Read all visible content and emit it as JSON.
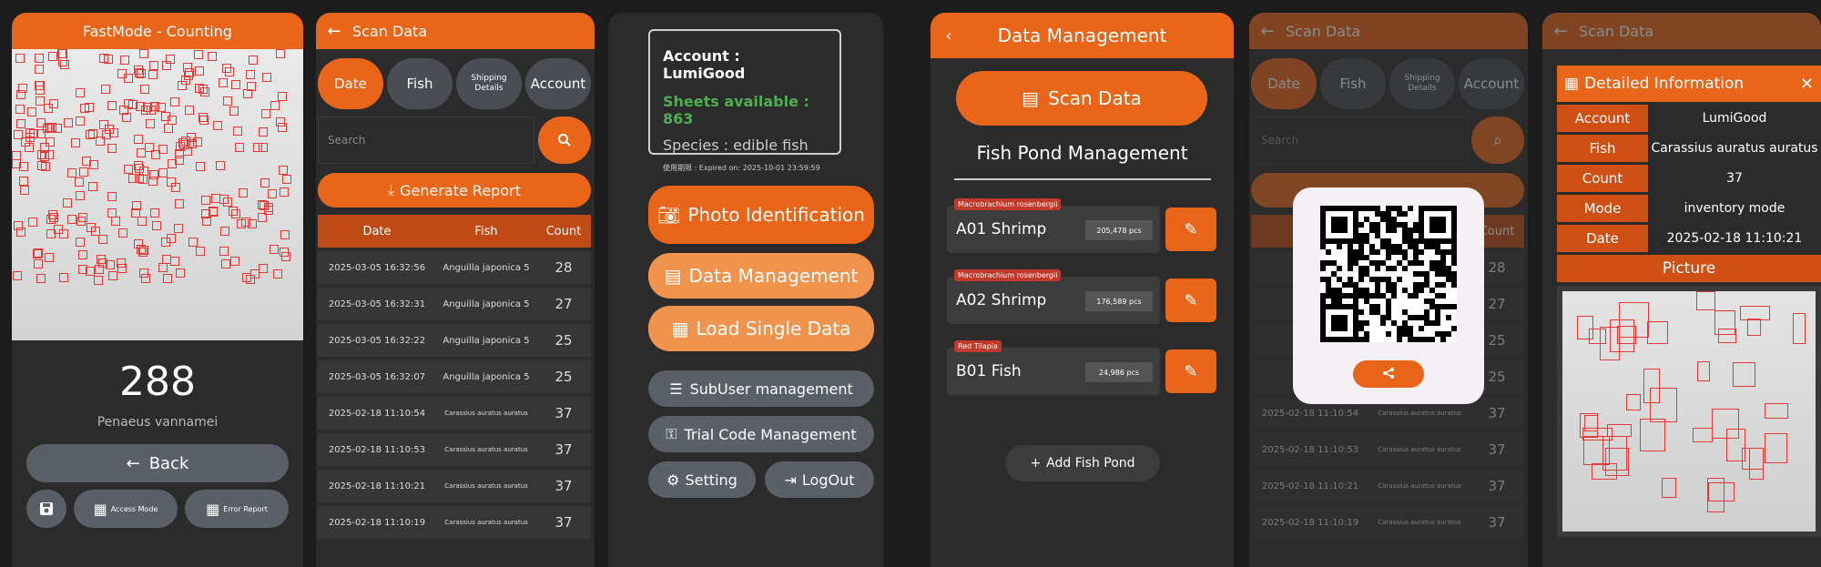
{
  "panel1": {
    "title": "FastMode - Counting",
    "count": "288",
    "species": "Penaeus vannamei",
    "back_label": "Back",
    "btn2_label": "Access Mode",
    "btn3_label": "Error Report"
  },
  "panel2": {
    "title": "Scan Data",
    "tabs": [
      "Date",
      "Fish",
      "Shipping Details",
      "Account"
    ],
    "search_placeholder": "Search",
    "generate_label": "Generate Report",
    "columns": [
      "Date",
      "Fish",
      "Count"
    ],
    "rows": [
      {
        "date": "2025-03-05 16:32:56",
        "fish": "Anguilla japonica 5",
        "count": "28"
      },
      {
        "date": "2025-03-05 16:32:31",
        "fish": "Anguilla japonica 5",
        "count": "27"
      },
      {
        "date": "2025-03-05 16:32:22",
        "fish": "Anguilla japonica 5",
        "count": "25"
      },
      {
        "date": "2025-03-05 16:32:07",
        "fish": "Anguilla japonica 5",
        "count": "25"
      },
      {
        "date": "2025-02-18 11:10:54",
        "fish": "Carassius auratus auratus",
        "count": "37"
      },
      {
        "date": "2025-02-18 11:10:53",
        "fish": "Carassius auratus auratus",
        "count": "37"
      },
      {
        "date": "2025-02-18 11:10:21",
        "fish": "Carassius auratus auratus",
        "count": "37"
      },
      {
        "date": "2025-02-18 11:10:19",
        "fish": "Carassius auratus auratus",
        "count": "37"
      }
    ]
  },
  "panel3": {
    "account": "Account : LumiGood",
    "sheets": "Sheets available : 863",
    "species": "Species : edible fish",
    "expired": "使用期限 : Expired on: 2025-10-01 23:59:59",
    "photo_id": "Photo Identification",
    "data_mgmt": "Data Management",
    "load_single": "Load Single Data",
    "subuser": "SubUser management",
    "trial_code": "Trial Code Management",
    "setting": "Setting",
    "logout": "LogOut"
  },
  "panel4": {
    "title": "Data Management",
    "scan_data": "Scan Data",
    "section_title": "Fish Pond Management",
    "ponds": [
      {
        "tag": "Macrobrachium rosenbergii",
        "name": "A01 Shrimp",
        "count": "205,478 pcs"
      },
      {
        "tag": "Macrobrachium rosenbergii",
        "name": "A02 Shrimp",
        "count": "176,589 pcs"
      },
      {
        "tag": "Red Tilapia",
        "name": "B01 Fish",
        "count": "24,986 pcs"
      }
    ],
    "add_pond": "Add Fish Pond"
  },
  "panel5": {
    "title": "Scan Data",
    "tabs": [
      "Date",
      "Fish",
      "Shipping Details",
      "Account"
    ],
    "search_placeholder": "Search",
    "count_header": "Count",
    "rows": [
      {
        "date": "2025",
        "count": "28"
      },
      {
        "date": "",
        "count": "27"
      },
      {
        "date": "",
        "count": "25"
      },
      {
        "date": "",
        "count": "25"
      },
      {
        "date": "2025-02-18 11:10:54",
        "fish": "Carassius auratus auratus",
        "count": "37"
      },
      {
        "date": "2025-02-18 11:10:53",
        "fish": "Carassius auratus auratus",
        "count": "37"
      },
      {
        "date": "2025-02-18 11:10:21",
        "fish": "Carassius auratus auratus",
        "count": "37"
      },
      {
        "date": "2025-02-18 11:10:19",
        "fish": "Carassius auratus auratus",
        "count": "37"
      }
    ]
  },
  "panel6": {
    "title": "Scan Data",
    "detail_title": "Detailed Information",
    "fields": [
      {
        "key": "Account",
        "value": "LumiGood"
      },
      {
        "key": "Fish",
        "value": "Carassius auratus auratus"
      },
      {
        "key": "Count",
        "value": "37"
      },
      {
        "key": "Mode",
        "value": "inventory mode"
      },
      {
        "key": "Date",
        "value": "2025-02-18 11:10:21"
      }
    ],
    "picture_label": "Picture"
  },
  "colors": {
    "accent": "#e8651a",
    "panel": "#2b2b2b",
    "success": "#4caf50"
  }
}
